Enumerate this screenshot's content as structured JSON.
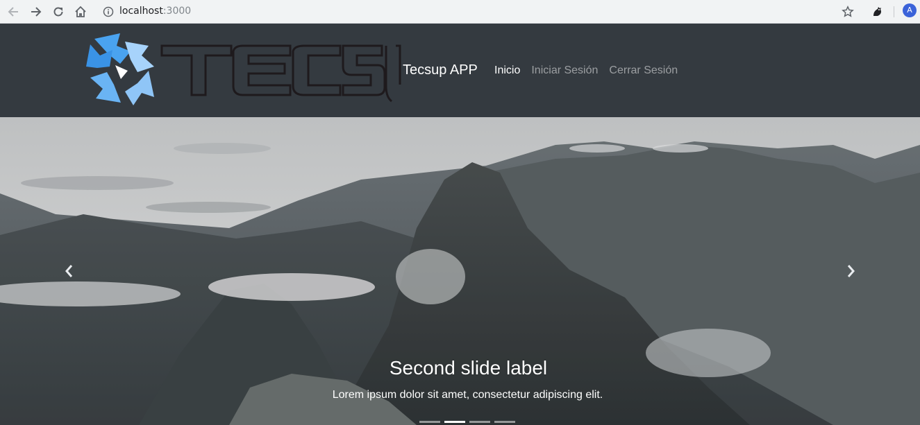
{
  "browser": {
    "url_host": "localhost",
    "url_port": ":3000",
    "avatar_initial": "A",
    "icons": [
      "back-icon",
      "forward-icon",
      "reload-icon",
      "home-icon",
      "info-icon",
      "star-icon",
      "extension-icon"
    ]
  },
  "navbar": {
    "logo_text": "TECSUP",
    "brand": "Tecsup APP",
    "links": [
      {
        "label": "Inicio",
        "active": true
      },
      {
        "label": "Iniciar Sesión",
        "active": false
      },
      {
        "label": "Cerrar Sesión",
        "active": false
      }
    ]
  },
  "carousel": {
    "caption_title": "Second slide label",
    "caption_text": "Lorem ipsum dolor sit amet, consectetur adipiscing elit.",
    "indicators": [
      false,
      true,
      false,
      false
    ],
    "active_slide_index": 1
  },
  "colors": {
    "navbar_bg": "#343a40",
    "logo_blue": "#4aa3f0",
    "logo_light_blue": "#a7d3fb"
  }
}
